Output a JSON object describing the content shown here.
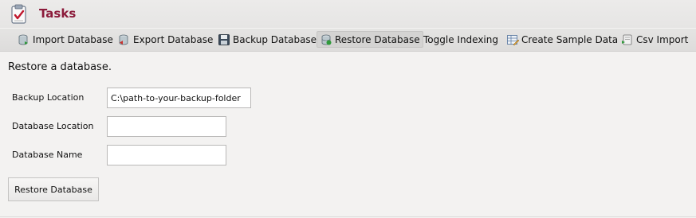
{
  "panel": {
    "title": "Tasks",
    "title_icon": "clipboard-check-icon"
  },
  "toolbar": {
    "items": [
      {
        "label": "Import Database",
        "icon": "database-import-icon"
      },
      {
        "label": "Export Database",
        "icon": "database-export-icon"
      },
      {
        "label": "Backup Database",
        "icon": "floppy-disk-icon"
      },
      {
        "label": "Restore Database",
        "icon": "database-restore-icon",
        "active": true
      },
      {
        "label": "Toggle Indexing",
        "icon": ""
      },
      {
        "label": "Create Sample Data",
        "icon": "table-pencil-icon"
      },
      {
        "label": "Csv Import",
        "icon": "csv-import-icon"
      }
    ]
  },
  "form": {
    "heading": "Restore a database.",
    "backup_location": {
      "label": "Backup Location",
      "value": "C:\\path-to-your-backup-folder"
    },
    "database_location": {
      "label": "Database Location",
      "value": ""
    },
    "database_name": {
      "label": "Database Name",
      "value": ""
    },
    "submit_label": "Restore Database"
  },
  "colors": {
    "title": "#8b1a3a",
    "background": "#f3f2f1",
    "toolbar": "#e0dfde",
    "active_tab": "#d4d3d2"
  }
}
